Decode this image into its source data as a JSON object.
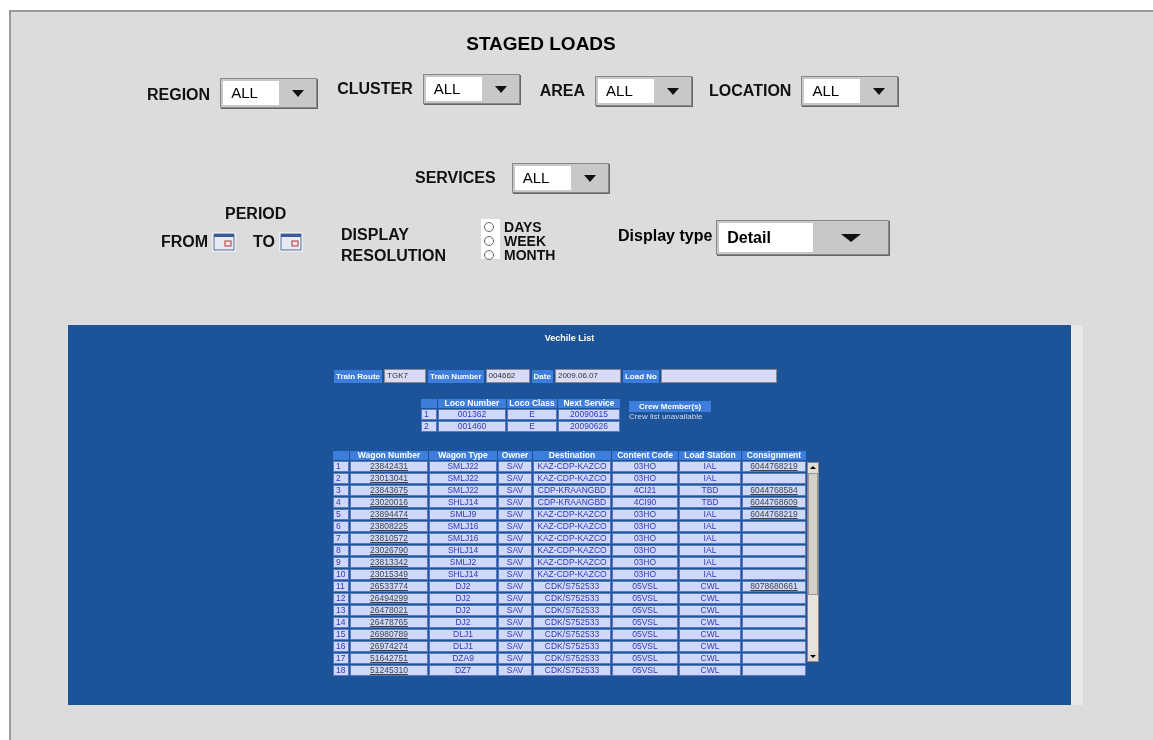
{
  "title": "STAGED LOADS",
  "filters": [
    {
      "label": "REGION",
      "value": "ALL"
    },
    {
      "label": "CLUSTER",
      "value": "ALL"
    },
    {
      "label": "AREA",
      "value": "ALL"
    },
    {
      "label": "LOCATION",
      "value": "ALL"
    }
  ],
  "services": {
    "label": "SERVICES",
    "value": "ALL"
  },
  "period": {
    "label": "PERIOD",
    "from": "FROM",
    "to": "TO"
  },
  "resolution": {
    "label": "DISPLAY RESOLUTION",
    "options": [
      {
        "label": "DAYS",
        "selected": false
      },
      {
        "label": "WEEK",
        "selected": false
      },
      {
        "label": "MONTH",
        "selected": false
      }
    ]
  },
  "display_type": {
    "label": "Display type",
    "value": "Detail"
  },
  "panel": {
    "title": "Vechile List",
    "fields": [
      {
        "label": "Train Route",
        "value": "TGK7"
      },
      {
        "label": "Train Number",
        "value": "004662"
      },
      {
        "label": "Date",
        "value": "2009.06.07"
      },
      {
        "label": "Load No"
      }
    ],
    "loco_table": {
      "columns": [
        "",
        "Loco Number",
        "Loco Class",
        "Next Service"
      ],
      "rows": [
        [
          "1",
          "001362",
          "E",
          "20090615"
        ],
        [
          "2",
          "001460",
          "E",
          "20090626"
        ]
      ]
    },
    "crew": {
      "button": "Crew Member(s)",
      "note": "Crew list unavailable"
    },
    "wagon_table": {
      "columns": [
        "",
        "Wagon Number",
        "Wagon Type",
        "Owner",
        "Destination",
        "Content Code",
        "Load Station",
        "Consignment"
      ],
      "rows": [
        [
          "1",
          "23842431",
          "SMLJ22",
          "SAV",
          "KAZ-CDP-KAZCO",
          "03HO",
          "IAL",
          "6044768219"
        ],
        [
          "2",
          "23013041",
          "SMLJ22",
          "SAV",
          "KAZ-CDP-KAZCO",
          "03HO",
          "IAL",
          ""
        ],
        [
          "3",
          "23843675",
          "SMLJ22",
          "SAV",
          "CDP-KRAANGBD",
          "4CI21",
          "TBD",
          "6044768584"
        ],
        [
          "4",
          "23020016",
          "SHLJ14",
          "SAV",
          "CDP-KRAANGBD",
          "4CI90",
          "TBD",
          "6044768609"
        ],
        [
          "5",
          "23894474",
          "SMLJ9",
          "SAV",
          "KAZ-CDP-KAZCO",
          "03HO",
          "IAL",
          "6044768219"
        ],
        [
          "6",
          "23808225",
          "SMLJ16",
          "SAV",
          "KAZ-CDP-KAZCO",
          "03HO",
          "IAL",
          ""
        ],
        [
          "7",
          "23810572",
          "SMLJ16",
          "SAV",
          "KAZ-CDP-KAZCO",
          "03HO",
          "IAL",
          ""
        ],
        [
          "8",
          "23026790",
          "SHLJ14",
          "SAV",
          "KAZ-CDP-KAZCO",
          "03HO",
          "IAL",
          ""
        ],
        [
          "9",
          "23813342",
          "SMLJ2",
          "SAV",
          "KAZ-CDP-KAZCO",
          "03HO",
          "IAL",
          ""
        ],
        [
          "10",
          "23015349",
          "SHLJ14",
          "SAV",
          "KAZ-CDP-KAZCO",
          "03HO",
          "IAL",
          ""
        ],
        [
          "11",
          "26533774",
          "DJ2",
          "SAV",
          "CDK/S752533",
          "05VSL",
          "CWL",
          "8078680661"
        ],
        [
          "12",
          "26494299",
          "DJ2",
          "SAV",
          "CDK/S752533",
          "05VSL",
          "CWL",
          ""
        ],
        [
          "13",
          "26478021",
          "DJ2",
          "SAV",
          "CDK/S752533",
          "05VSL",
          "CWL",
          ""
        ],
        [
          "14",
          "26478765",
          "DJ2",
          "SAV",
          "CDK/S752533",
          "05VSL",
          "CWL",
          ""
        ],
        [
          "15",
          "26980789",
          "DLJ1",
          "SAV",
          "CDK/S752533",
          "05VSL",
          "CWL",
          ""
        ],
        [
          "16",
          "26974274",
          "DLJ1",
          "SAV",
          "CDK/S752533",
          "05VSL",
          "CWL",
          ""
        ],
        [
          "17",
          "51642751",
          "DZA9",
          "SAV",
          "CDK/S752533",
          "05VSL",
          "CWL",
          ""
        ],
        [
          "18",
          "51245310",
          "DZ7",
          "SAV",
          "CDK/S752533",
          "05VSL",
          "CWL",
          ""
        ]
      ]
    }
  }
}
